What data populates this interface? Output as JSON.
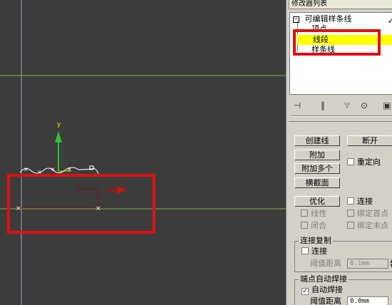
{
  "modifier_list": {
    "title": "修改器列表"
  },
  "stack": {
    "root": "可编辑样条线",
    "expand_symbol": "−",
    "checked_symbol": "✓",
    "items": [
      "顶点",
      "线段",
      "样条线"
    ]
  },
  "viewport": {
    "axis_label_y": "y",
    "background": "#3c3c3c",
    "grid_color": "#7fb43a",
    "highlight_color": "#e00000"
  },
  "geometry": {
    "buttons": {
      "create_line": "创建线",
      "break": "断开",
      "attach": "附加",
      "attach_multiple": "附加多个",
      "cross_section": "横截面",
      "optimize": "优化"
    },
    "checkboxes": {
      "reorient": {
        "label": "重定向",
        "checked": false
      },
      "connect_opt": {
        "label": "连接",
        "checked": false
      },
      "linear": {
        "label": "线性",
        "checked": false
      },
      "bind_first": {
        "label": "绑定首点",
        "checked": false
      },
      "closed": {
        "label": "闭合",
        "checked": false
      },
      "bind_last": {
        "label": "绑定末点",
        "checked": false
      }
    },
    "connect_copy": {
      "title": "连接复制",
      "connect": {
        "label": "连接",
        "checked": false
      },
      "threshold_label": "阈值距离",
      "threshold_value": "0.1mm"
    },
    "end_weld": {
      "title": "端点自动焊接",
      "auto_weld": {
        "label": "自动焊接",
        "checked": true,
        "mark": "✓"
      },
      "threshold_label": "阈值距离",
      "threshold_value": "0.0mm"
    }
  }
}
